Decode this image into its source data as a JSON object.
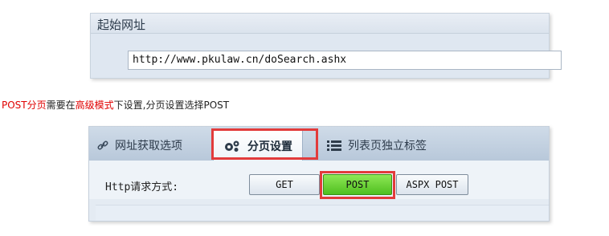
{
  "start_url_panel": {
    "title": "起始网址",
    "url_value": "http://www.pkulaw.cn/doSearch.ashx"
  },
  "description": {
    "part1": "POST分页",
    "part2": "需要在",
    "part3": "高级模式",
    "part4": "下设置,分页设置选择POST"
  },
  "tabs": [
    {
      "label": "网址获取选项",
      "icon": "link-icon"
    },
    {
      "label": "分页设置",
      "icon": "gears-icon"
    },
    {
      "label": "列表页独立标签",
      "icon": "list-icon"
    }
  ],
  "http_method": {
    "label": "Http请求方式:",
    "options": [
      "GET",
      "POST",
      "ASPX POST"
    ],
    "selected": "POST"
  },
  "colors": {
    "highlight": "#e23b3b",
    "selected_button": "#58c42a",
    "emphasis_text": "#e00000"
  }
}
